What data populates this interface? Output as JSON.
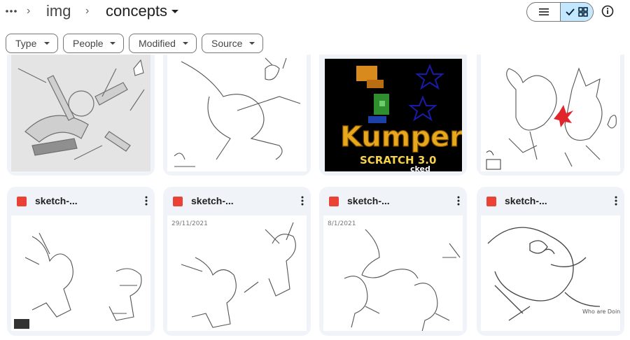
{
  "breadcrumb": {
    "overflow_icon": "more-horiz-icon",
    "items": [
      "img",
      "concepts"
    ]
  },
  "view_toggle": {
    "list_icon": "list-icon",
    "grid_icon": "grid-icon",
    "selected": "grid"
  },
  "filters": [
    "Type",
    "People",
    "Modified",
    "Source"
  ],
  "grid": {
    "top_row": [
      {
        "thumb": "gears-sketch"
      },
      {
        "thumb": "character-sketch"
      },
      {
        "thumb": "kumper-logo",
        "logo_text": "Kumper",
        "logo_sub": "SCRATCH 3.0",
        "logo_tail": "cked"
      },
      {
        "thumb": "fight-sketch"
      }
    ],
    "files": [
      {
        "name": "sketch-..."
      },
      {
        "name": "sketch-...",
        "handwriting": "29/11/2021"
      },
      {
        "name": "sketch-...",
        "handwriting": "8/1/2021"
      },
      {
        "name": "sketch-...",
        "handwriting": "Who are Doing?"
      }
    ]
  },
  "colors": {
    "accent_selected": "#c2e7ff",
    "card_bg": "#f0f4f9",
    "image_icon": "#ea4335"
  }
}
